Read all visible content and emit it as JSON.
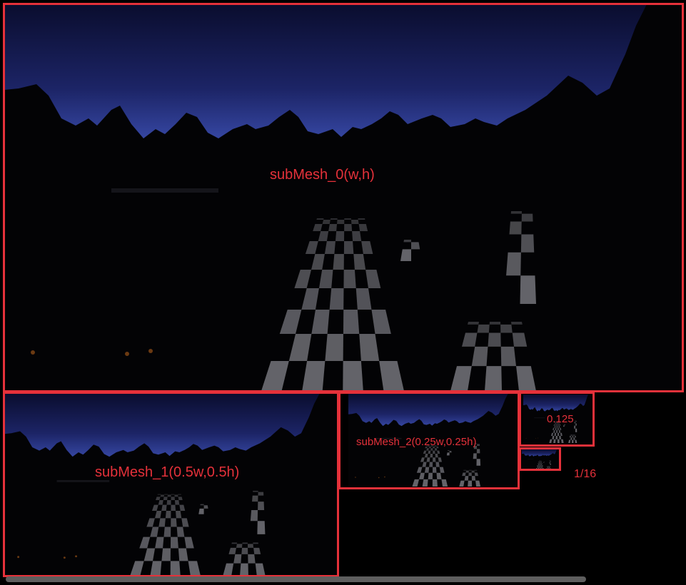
{
  "meshes": [
    {
      "id": "mesh0",
      "label": "subMesh_0(w,h)",
      "level": 1.0
    },
    {
      "id": "mesh1",
      "label": "subMesh_1(0.5w,0.5h)",
      "level": 0.5
    },
    {
      "id": "mesh2",
      "label": "subMesh_2(0.25w,0.25h)",
      "level": 0.25
    },
    {
      "id": "mesh3",
      "label": "0.125",
      "level": 0.125
    },
    {
      "id": "mesh4",
      "label": "1/16",
      "level": 0.0625
    }
  ],
  "colors": {
    "frame": "#e5313a",
    "label": "#e5313a",
    "sky_top": "#0a0d2e",
    "sky_horizon": "#3f53b8",
    "checker_light": "#6e6e74",
    "checker_dark": "#111114",
    "background": "#000000",
    "scrollbar": "#5e5e5e"
  },
  "icons": [
    "scene-render-thumbnail"
  ]
}
